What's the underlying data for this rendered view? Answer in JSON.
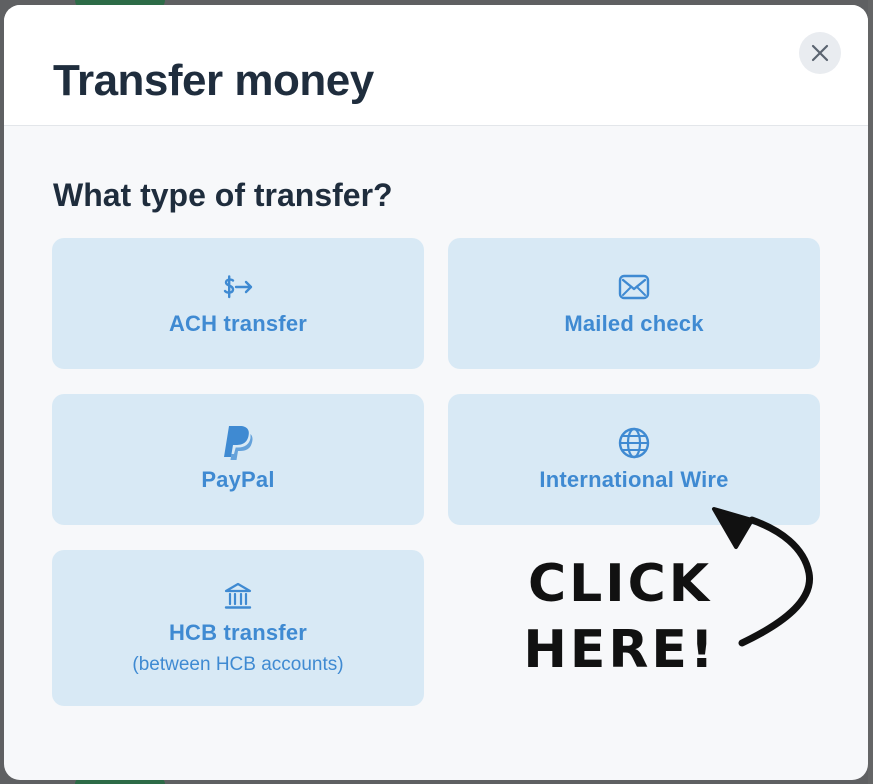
{
  "modal": {
    "title": "Transfer money",
    "close_icon": "close-icon"
  },
  "section": {
    "heading": "What type of transfer?"
  },
  "options": [
    {
      "id": "ach",
      "label": "ACH transfer",
      "sublabel": "",
      "icon": "dollar-arrow-icon"
    },
    {
      "id": "mailed",
      "label": "Mailed check",
      "sublabel": "",
      "icon": "envelope-icon"
    },
    {
      "id": "paypal",
      "label": "PayPal",
      "sublabel": "",
      "icon": "paypal-icon"
    },
    {
      "id": "wire",
      "label": "International Wire",
      "sublabel": "",
      "icon": "globe-icon"
    },
    {
      "id": "hcb",
      "label": "HCB transfer",
      "sublabel": "(between HCB accounts)",
      "icon": "bank-icon"
    }
  ],
  "annotation": {
    "line1": "CLICK",
    "line2": "HERE!"
  },
  "colors": {
    "accent": "#3f8ad2",
    "card_bg": "#d8e9f5",
    "title": "#1f2d3d",
    "modal_bg": "#f7f8fa"
  }
}
